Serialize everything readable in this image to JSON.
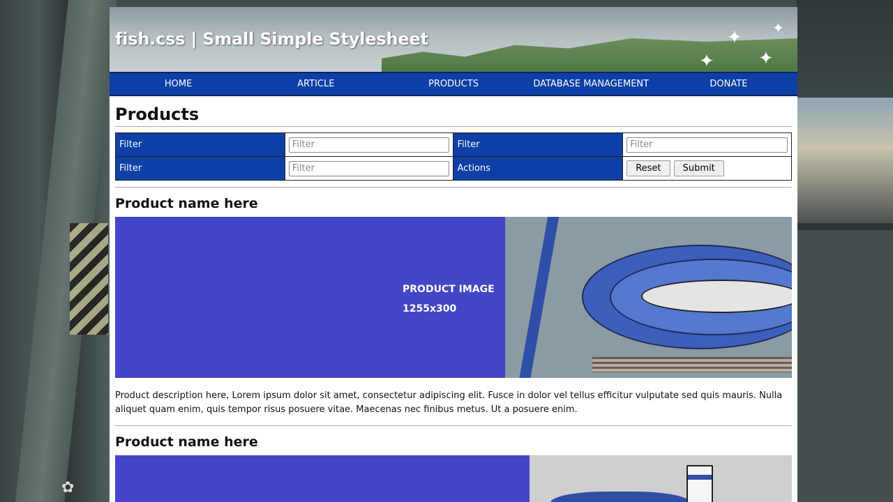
{
  "site": {
    "title": "fish.css | Small Simple Stylesheet"
  },
  "nav": {
    "items": [
      "HOME",
      "ARTICLE",
      "PRODUCTS",
      "DATABASE MANAGEMENT",
      "DONATE"
    ]
  },
  "page": {
    "heading": "Products"
  },
  "filters": {
    "label1": "Filter",
    "placeholder1": "Filter",
    "label2": "Filter",
    "placeholder2": "Filter",
    "label3": "Filter",
    "placeholder3": "Filter",
    "actions_label": "Actions",
    "reset_label": "Reset",
    "submit_label": "Submit"
  },
  "products": [
    {
      "name": "Product name here",
      "image_line1": "PRODUCT IMAGE",
      "image_line2": "1255x300",
      "description": "Product description here, Lorem ipsum dolor sit amet, consectetur adipiscing elit. Fusce in dolor vel tellus efficitur vulputate sed quis mauris. Nulla aliquet quam enim, quis tempor risus posuere vitae. Maecenas nec finibus metus. Ut a posuere enim."
    },
    {
      "name": "Product name here"
    }
  ],
  "colors": {
    "nav_blue": "#0d3fa6",
    "image_blue": "#4446c8"
  }
}
